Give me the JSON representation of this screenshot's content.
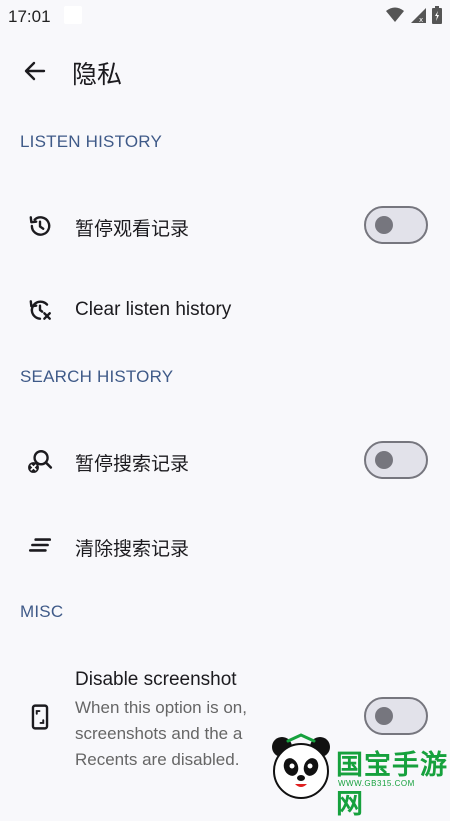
{
  "status_bar": {
    "time": "17:01",
    "icons": [
      "wifi-icon",
      "signal-icon",
      "battery-icon"
    ]
  },
  "header": {
    "back_icon": "arrow-left-icon",
    "title": "隐私"
  },
  "sections": {
    "listen_history": {
      "title": "LISTEN HISTORY",
      "pause_label": "暂停观看记录",
      "pause_switch_on": false,
      "clear_label": "Clear listen history"
    },
    "search_history": {
      "title": "SEARCH HISTORY",
      "pause_label": "暂停搜索记录",
      "pause_switch_on": false,
      "clear_label": "清除搜索记录"
    },
    "misc": {
      "title": "MISC",
      "screenshot_label": "Disable screenshot",
      "screenshot_desc": "When this option is on, screenshots and the a Recents are disabled.",
      "screenshot_switch_on": false
    }
  },
  "watermark": {
    "text": "国宝手游网",
    "url": "WWW.GB315.COM"
  },
  "colors": {
    "background": "#f8f8fb",
    "section_header": "#3f5a88",
    "switch_outline": "#76767e",
    "switch_track": "#e2e2ea",
    "watermark": "#16a13d"
  }
}
